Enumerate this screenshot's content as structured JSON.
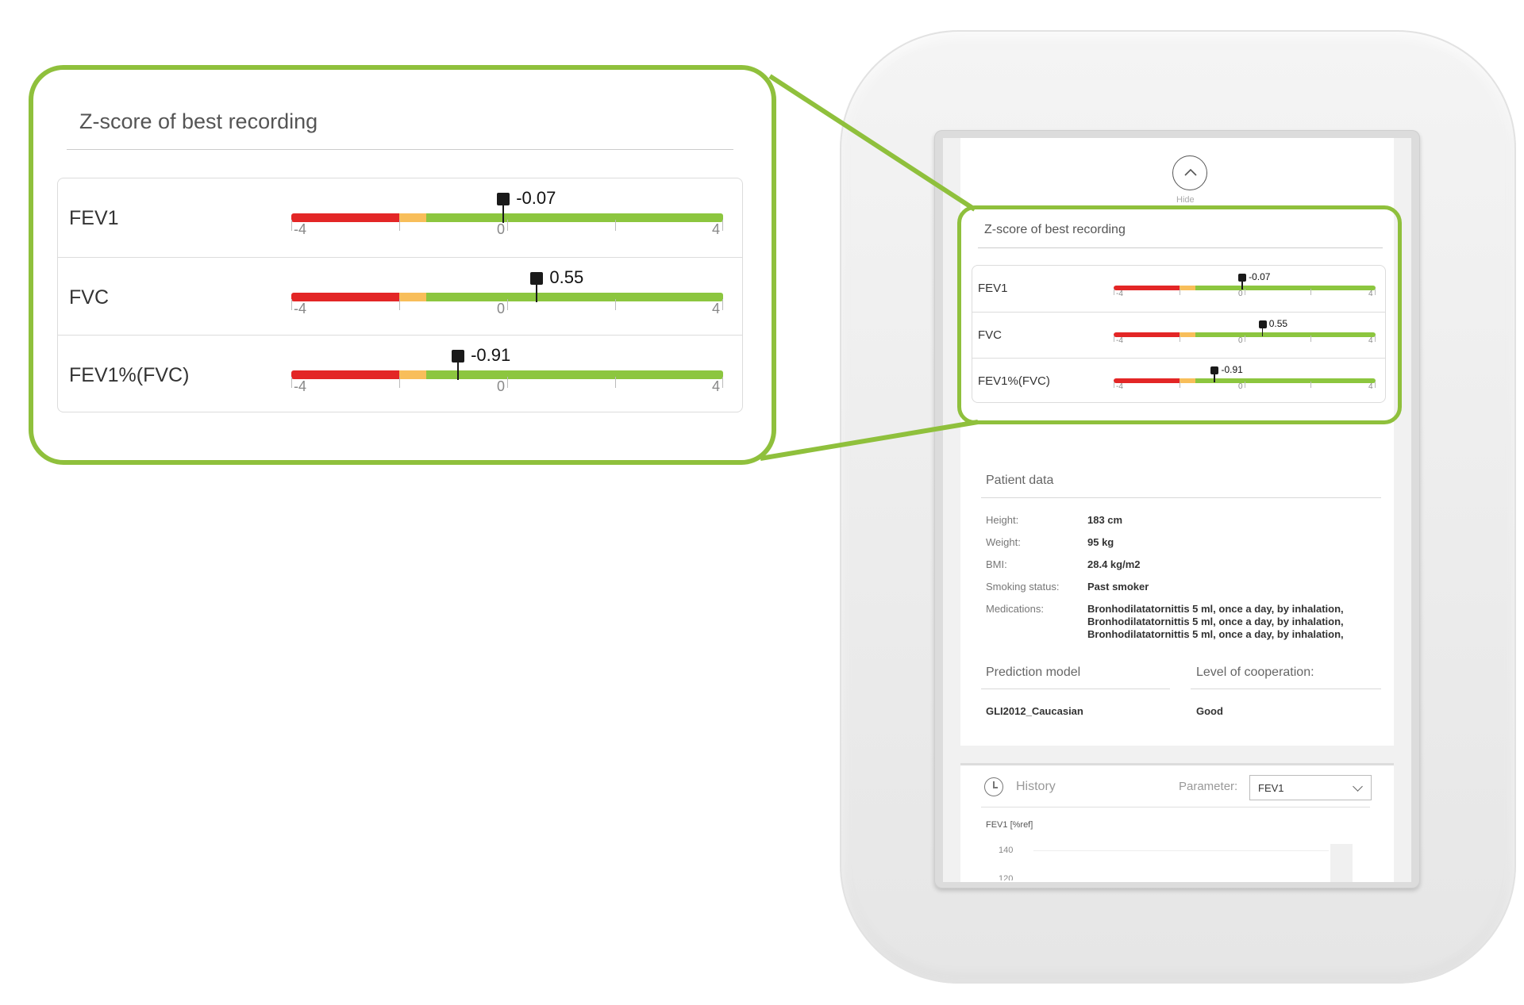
{
  "zscore": {
    "title": "Z-score of best recording",
    "scale": {
      "min": -4,
      "max": 4,
      "tick_labels": [
        "-4",
        "0",
        "4"
      ]
    },
    "colors": {
      "red": "#e32626",
      "orange": "#f8be5a",
      "green": "#8cc63f",
      "frame": "#8fc03c"
    },
    "rows": [
      {
        "label": "FEV1",
        "value": -0.07,
        "value_text": "-0.07"
      },
      {
        "label": "FVC",
        "value": 0.55,
        "value_text": "0.55"
      },
      {
        "label": "FEV1%(FVC)",
        "value": -0.91,
        "value_text": "-0.91"
      }
    ]
  },
  "device": {
    "hide_label": "Hide",
    "patient": {
      "title": "Patient data",
      "rows": [
        {
          "key": "Height:",
          "value": "183 cm"
        },
        {
          "key": "Weight:",
          "value": "95 kg"
        },
        {
          "key": "BMI:",
          "value": "28.4 kg/m2"
        },
        {
          "key": "Smoking status:",
          "value": "Past smoker"
        },
        {
          "key": "Medications:",
          "value": "Bronhodilatatornittis 5 ml, once a day, by inhalation,\nBronhodilatatornittis 5 ml, once a day, by inhalation,\nBronhodilatatornittis 5 ml, once a day, by inhalation,"
        }
      ]
    },
    "prediction": {
      "title": "Prediction model",
      "value": "GLI2012_Caucasian"
    },
    "cooperation": {
      "title": "Level of cooperation:",
      "value": "Good"
    },
    "history": {
      "title": "History",
      "parameter_label": "Parameter:",
      "parameter_value": "FEV1",
      "chart_ylabel": "FEV1 [%ref]",
      "y_ticks": [
        "140",
        "120"
      ]
    }
  }
}
